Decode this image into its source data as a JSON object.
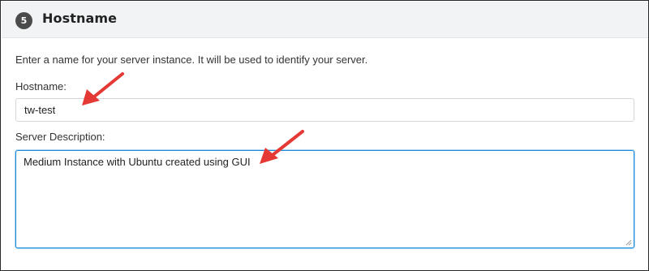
{
  "section": {
    "step_number": "5",
    "title": "Hostname"
  },
  "intro_text": "Enter a name for your server instance. It will be used to identify your server.",
  "hostname": {
    "label": "Hostname:",
    "value": "tw-test"
  },
  "description": {
    "label": "Server Description:",
    "value": "Medium Instance with Ubuntu created using GUI"
  },
  "colors": {
    "header_bg": "#f2f3f4",
    "badge_bg": "#4b4b4b",
    "focus_border": "#1a8ad8",
    "annotation_arrow": "#e53935"
  },
  "icons": [
    "resize-grip-icon",
    "annotation-arrow"
  ]
}
